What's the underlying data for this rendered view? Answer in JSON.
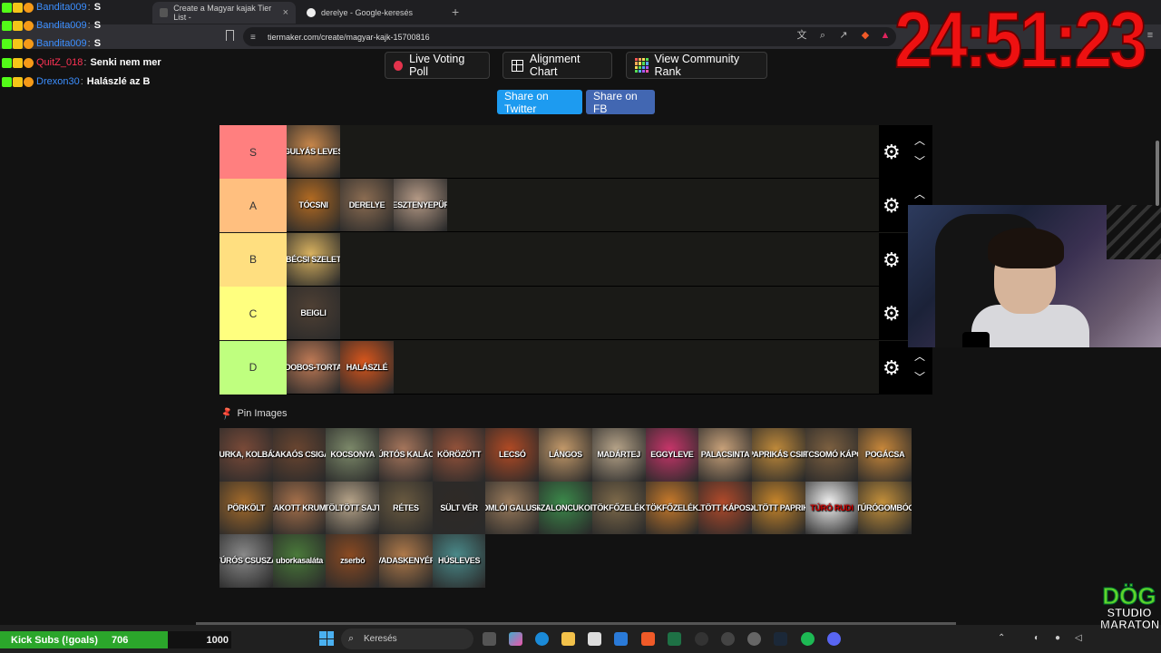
{
  "browser": {
    "tabs": [
      {
        "title": "Create a Magyar kajak Tier List -",
        "active": true
      },
      {
        "title": "derelye - Google-keresés",
        "active": false
      }
    ],
    "address": "tiermaker.com/create/magyar-kajk-15700816"
  },
  "buttons": {
    "live_voting": "Live Voting Poll",
    "alignment_chart": "Alignment Chart",
    "community_rank": "View Community Rank",
    "share_twitter": "Share on Twitter",
    "share_fb": "Share on FB"
  },
  "tiers": [
    {
      "label": "S",
      "color": "#ff7f7f",
      "items": [
        {
          "text": "GULYÁS LEVES",
          "bg": "#c8874a"
        }
      ]
    },
    {
      "label": "A",
      "color": "#ffbf7f",
      "items": [
        {
          "text": "TÓCSNI",
          "bg": "#b36b22"
        },
        {
          "text": "DERELYE",
          "bg": "#8c6d52"
        },
        {
          "text": "GESZTENYEPÜRÉ",
          "bg": "#b59a86"
        }
      ]
    },
    {
      "label": "B",
      "color": "#ffdf80",
      "items": [
        {
          "text": "BÉCSI SZELET",
          "bg": "#d9b25f"
        }
      ]
    },
    {
      "label": "C",
      "color": "#ffff7f",
      "items": [
        {
          "text": "BEIGLI",
          "bg": "#4f4034"
        }
      ]
    },
    {
      "label": "D",
      "color": "#bfff7f",
      "items": [
        {
          "text": "DOBOS-TORTA",
          "bg": "#c07a55"
        },
        {
          "text": "HALÁSZLÉ",
          "bg": "#d9561c"
        }
      ]
    }
  ],
  "pin_label": "Pin Images",
  "pool": [
    {
      "text": "URKA, KOLBÁ",
      "bg": "#7a4a38"
    },
    {
      "text": "KAKAÓS CSIGA",
      "bg": "#6a4530"
    },
    {
      "text": "KOCSONYA",
      "bg": "#7d8a6a"
    },
    {
      "text": "ÚRTÓS KALÁC",
      "bg": "#a7765c"
    },
    {
      "text": "KÖRÖZÖTT",
      "bg": "#94523a"
    },
    {
      "text": "LECSÓ",
      "bg": "#b24a24"
    },
    {
      "text": "LÁNGOS",
      "bg": "#c49a6a"
    },
    {
      "text": "MADÁRTEJ",
      "bg": "#b7a489"
    },
    {
      "text": "EGGYLEVE",
      "bg": "#c8356a"
    },
    {
      "text": "PALACSINTA",
      "bg": "#c9a27a"
    },
    {
      "text": "PAPRIKÁS CSIR",
      "bg": "#c08a3a"
    },
    {
      "text": "KRAUTCSOMÓ KÁPOSZTA",
      "bg": "#7d6040"
    },
    {
      "text": "POGÁCSA",
      "bg": "#c9883a"
    },
    {
      "text": "PÖRKÖLT",
      "bg": "#a36a2a"
    },
    {
      "text": "RAKOTT KRUMP",
      "bg": "#a6704a"
    },
    {
      "text": "TÖLTÖTT SAJT",
      "bg": "#b8a58a"
    },
    {
      "text": "RÉTES",
      "bg": "#6a5a40"
    },
    {
      "text": "SÜLT VÉR",
      "bg": "#2f2a26"
    },
    {
      "text": "SOMLÓI GALUSKA",
      "bg": "#9a7a5a"
    },
    {
      "text": "SZALONCUKOR",
      "bg": "#3b8a4a"
    },
    {
      "text": "TÖKFŐZELÉK",
      "bg": "#7e6a4a"
    },
    {
      "text": "TÖKFŐZELÉK",
      "bg": "#c87a2a"
    },
    {
      "text": "TÖLTÖTT KÁPOSZTA",
      "bg": "#b24a2a"
    },
    {
      "text": "TÖLTÖTT PAPRIKA",
      "bg": "#c8862a"
    },
    {
      "text": "TÚRÓ RUDI",
      "bg": "#f2f2f2"
    },
    {
      "text": "TÚRÓGOMBÓC",
      "bg": "#c4903a"
    },
    {
      "text": "TÚRÓS CSUSZA",
      "bg": "#8a8a8a"
    },
    {
      "text": "uborkasaláta",
      "bg": "#4a7a3a"
    },
    {
      "text": "zserbó",
      "bg": "#8a4a22"
    },
    {
      "text": "VADASKENYÉR",
      "bg": "#b07a4a"
    },
    {
      "text": "HÚSLEVES",
      "bg": "#4a8a8a"
    }
  ],
  "chat": [
    {
      "user": "Bandita009",
      "msg": "S",
      "color": "#3c8fff"
    },
    {
      "user": "Bandita009",
      "msg": "S",
      "color": "#3c8fff"
    },
    {
      "user": "Bandita009",
      "msg": "S",
      "color": "#3c8fff"
    },
    {
      "user": "QuitZ_018",
      "msg": "Senki nem mer",
      "color": "#ff3355"
    },
    {
      "user": "Drexon30",
      "msg": "Halászlé az B",
      "color": "#3c8fff"
    }
  ],
  "timer": "24:51:23",
  "kick_subs": {
    "label": "Kick Subs (!goals)",
    "current": "706",
    "goal": "1000",
    "progress": 0.706
  },
  "taskbar": {
    "search_placeholder": "Keresés"
  },
  "logo": {
    "line1": "DÖG",
    "line2": "STUDIO",
    "line3": "MARATON"
  },
  "colors": {
    "accent_twitter": "#1d9bf0",
    "accent_fb": "#4267b2",
    "timer": "#ee1111",
    "kick": "#2ba62b"
  }
}
